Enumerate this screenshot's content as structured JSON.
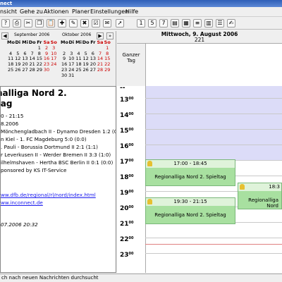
{
  "window": {
    "title": "nect"
  },
  "menu": [
    "nsicht",
    "Gehe zu",
    "Aktionen",
    "Planer",
    "Einstellungen",
    "Hilfe"
  ],
  "calendar": {
    "month1": "September 2006",
    "month2": "Oktober 2006",
    "weekdays": [
      "Mo",
      "Di",
      "Mi",
      "Do",
      "Fr",
      "Sa",
      "So"
    ],
    "rows1": [
      [
        "",
        "",
        "",
        "",
        "1",
        "2",
        "3"
      ],
      [
        "4",
        "5",
        "6",
        "7",
        "8",
        "9",
        "10"
      ],
      [
        "11",
        "12",
        "13",
        "14",
        "15",
        "16",
        "17"
      ],
      [
        "18",
        "19",
        "20",
        "21",
        "22",
        "23",
        "24"
      ],
      [
        "25",
        "26",
        "27",
        "28",
        "29",
        "30",
        ""
      ],
      [
        "",
        "",
        "",
        "",
        "",
        "",
        ""
      ]
    ],
    "rows2": [
      [
        "",
        "",
        "",
        "",
        "",
        "",
        "1"
      ],
      [
        "2",
        "3",
        "4",
        "5",
        "6",
        "7",
        "8"
      ],
      [
        "9",
        "10",
        "11",
        "12",
        "13",
        "14",
        "15"
      ],
      [
        "16",
        "17",
        "18",
        "19",
        "20",
        "21",
        "22"
      ],
      [
        "23",
        "24",
        "25",
        "26",
        "27",
        "28",
        "29"
      ],
      [
        "30",
        "31",
        "",
        "",
        "",
        "",
        ""
      ]
    ]
  },
  "day": {
    "title": "Mittwoch, 9. August 2006",
    "daynum": "221",
    "allday_label1": "Ganzer",
    "allday_label2": "Tag"
  },
  "hours": [
    "13",
    "14",
    "15",
    "16",
    "17",
    "18",
    "19",
    "20",
    "21",
    "22",
    "23"
  ],
  "hour_sup": "00",
  "events": [
    {
      "time": "17:00 - 18:45",
      "title": "Regionalliga Nord 2. Spieltag"
    },
    {
      "time": "19:30 - 21:15",
      "title": "Regionalliga Nord 2. Spieltag"
    },
    {
      "time": "18:3",
      "title": "Regionalliga Nord"
    }
  ],
  "text": {
    "heading1": "nalliga Nord 2.",
    "heading2": "tag",
    "time": "0 - 21:15",
    "date": "8.2006",
    "lines": [
      "Mönchengladbach II - Dynamo Dresden 1:2 (0:1)",
      "n Kiel - 1. FC Magdeburg 5:0 (0:0)",
      ". Pauli - Borussia Dortmund II 2:1 (1:1)",
      "r Leverkusen II - Werder Bremen II 3:3 (1:0)",
      "ilhelmshaven - Hertha BSC Berlin II 0:1 (0:0)",
      "",
      "ponsored by KS IT-Service"
    ],
    "link1": "ww.dfb.de/regional/rl/nord/index.html",
    "link2": "ww.inconnect.de",
    "footer": "07.2006 20:32"
  },
  "status": "ch nach neuen Nachrichten durchsucht",
  "colors": {
    "event": "#a8e0a0",
    "event_head": "#dff3da",
    "work_bg": "#dcdcf8",
    "today": "#ffffff"
  }
}
